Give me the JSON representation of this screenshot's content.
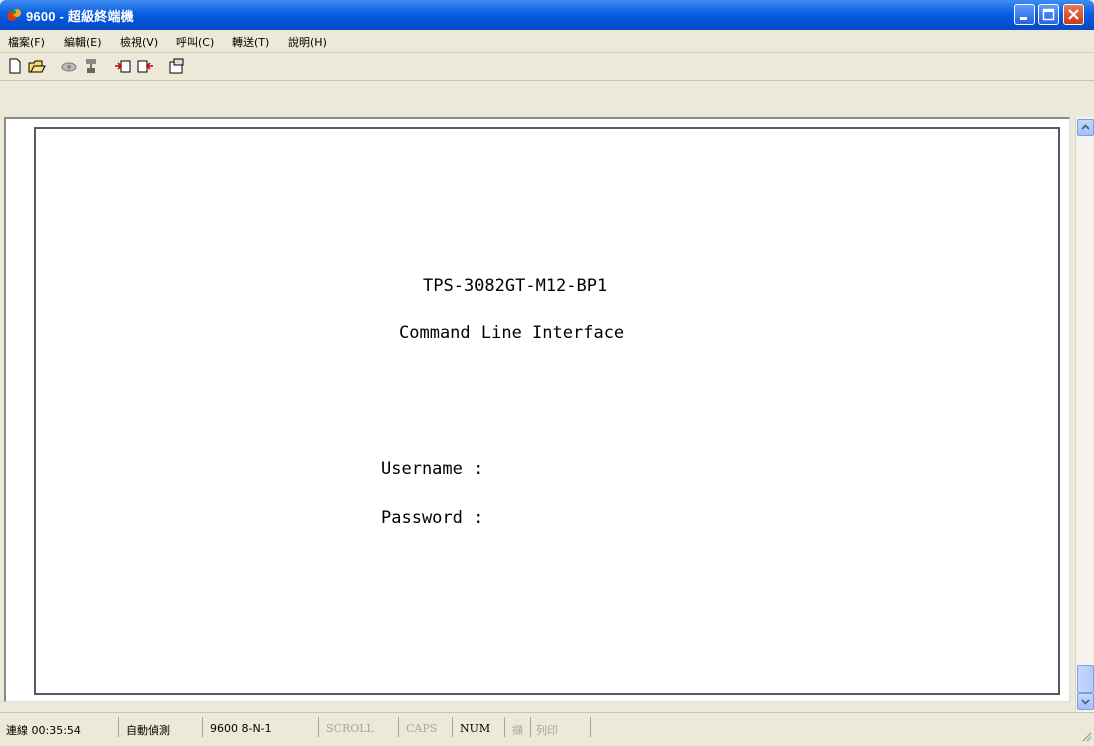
{
  "window": {
    "title": "9600 - 超級終端機"
  },
  "menu": {
    "items": [
      "檔案(F)",
      "編輯(E)",
      "檢視(V)",
      "呼叫(C)",
      "轉送(T)",
      "說明(H)"
    ]
  },
  "toolbar": {
    "icons": [
      "new-icon",
      "open-icon",
      "call-icon",
      "disconnect-icon",
      "send-icon",
      "receive-icon",
      "properties-icon"
    ]
  },
  "terminal": {
    "device_name": "TPS-3082GT-M12-BP1",
    "subtitle": "Command Line Interface",
    "username_prompt": "Username :",
    "password_prompt": "Password :"
  },
  "status": {
    "connected": "連線 00:35:54",
    "detect": "自動偵測",
    "settings": "9600 8-N-1",
    "scroll": "SCROLL",
    "caps": "CAPS",
    "num": "NUM",
    "capture": "擷",
    "print": "列印"
  },
  "colors": {
    "title_bar": "#0a5fe0",
    "close_button": "#c8381a",
    "chrome": "#ece9d8"
  }
}
